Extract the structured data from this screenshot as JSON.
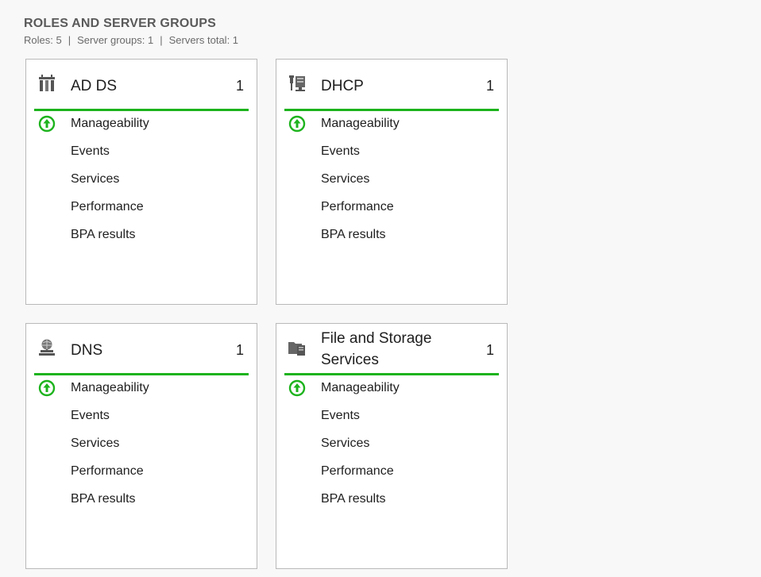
{
  "section": {
    "title": "ROLES AND SERVER GROUPS",
    "roles_label": "Roles: 5",
    "separator": "|",
    "groups_label": "Server groups: 1",
    "servers_label": "Servers total: 1"
  },
  "colors": {
    "status_ok": "#1db31d",
    "tile_border": "#b9b9b9",
    "title_text": "#5a5a5a"
  },
  "tiles": [
    {
      "name": "AD DS",
      "icon": "ad-ds-icon",
      "count": "1",
      "rows": [
        {
          "label": "Manageability",
          "status": "ok-up-arrow"
        },
        {
          "label": "Events"
        },
        {
          "label": "Services"
        },
        {
          "label": "Performance"
        },
        {
          "label": "BPA results"
        }
      ]
    },
    {
      "name": "DHCP",
      "icon": "dhcp-icon",
      "count": "1",
      "rows": [
        {
          "label": "Manageability",
          "status": "ok-up-arrow"
        },
        {
          "label": "Events"
        },
        {
          "label": "Services"
        },
        {
          "label": "Performance"
        },
        {
          "label": "BPA results"
        }
      ]
    },
    {
      "name": "DNS",
      "icon": "dns-icon",
      "count": "1",
      "rows": [
        {
          "label": "Manageability",
          "status": "ok-up-arrow"
        },
        {
          "label": "Events"
        },
        {
          "label": "Services"
        },
        {
          "label": "Performance"
        },
        {
          "label": "BPA results"
        }
      ]
    },
    {
      "name": "File and Storage Services",
      "icon": "file-storage-icon",
      "count": "1",
      "rows": [
        {
          "label": "Manageability",
          "status": "ok-up-arrow"
        },
        {
          "label": "Events"
        },
        {
          "label": "Services"
        },
        {
          "label": "Performance"
        },
        {
          "label": "BPA results"
        }
      ]
    }
  ]
}
